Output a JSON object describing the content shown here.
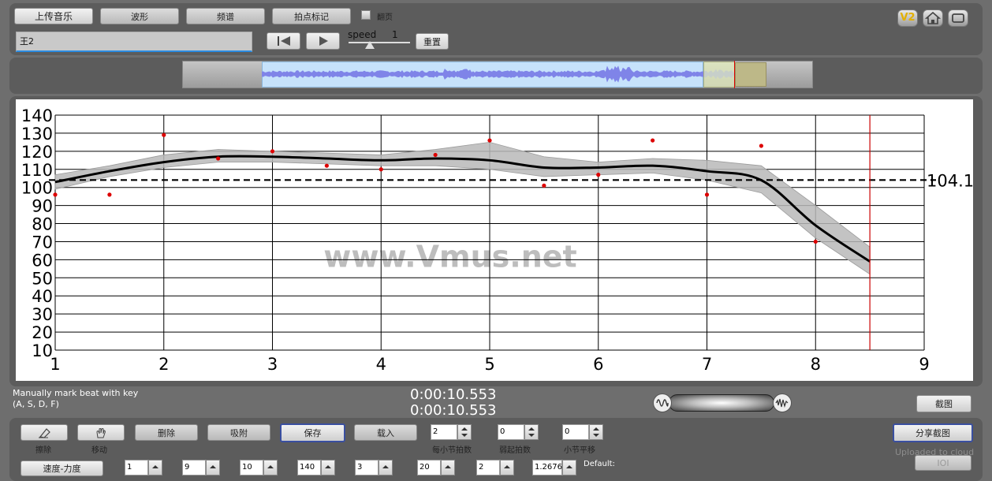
{
  "toolbar": {
    "upload_label": "上传音乐",
    "waveform_label": "波形",
    "spectrum_label": "频谱",
    "beat_mark_label": "拍点标记",
    "page_turn_label": "翻页",
    "track_name": "王2",
    "speed_label": "speed",
    "speed_value": "1",
    "reset_label": "重置",
    "v2_label": "V2"
  },
  "chart_data": {
    "type": "scatter",
    "xlim": [
      1,
      9
    ],
    "ylim": [
      10,
      140
    ],
    "x_ticks": [
      "1",
      "2",
      "3",
      "4",
      "5",
      "6",
      "7",
      "8",
      "9"
    ],
    "y_ticks": [
      "140",
      "130",
      "120",
      "110",
      "100",
      "90",
      "80",
      "70",
      "60",
      "50",
      "40",
      "30",
      "20",
      "10"
    ],
    "points": [
      {
        "x": 1.0,
        "y": 96
      },
      {
        "x": 1.5,
        "y": 96
      },
      {
        "x": 2.0,
        "y": 129
      },
      {
        "x": 2.5,
        "y": 116
      },
      {
        "x": 3.0,
        "y": 120
      },
      {
        "x": 3.5,
        "y": 112
      },
      {
        "x": 4.0,
        "y": 110
      },
      {
        "x": 4.5,
        "y": 118
      },
      {
        "x": 5.0,
        "y": 126
      },
      {
        "x": 5.5,
        "y": 101
      },
      {
        "x": 6.0,
        "y": 107
      },
      {
        "x": 6.5,
        "y": 126
      },
      {
        "x": 7.0,
        "y": 96
      },
      {
        "x": 7.5,
        "y": 123
      },
      {
        "x": 8.0,
        "y": 70
      }
    ],
    "trend": [
      {
        "x": 1.0,
        "y": 103,
        "lo": 99,
        "hi": 107
      },
      {
        "x": 1.5,
        "y": 109,
        "lo": 106,
        "hi": 112
      },
      {
        "x": 2.0,
        "y": 114,
        "lo": 111,
        "hi": 118
      },
      {
        "x": 2.5,
        "y": 117,
        "lo": 114,
        "hi": 121
      },
      {
        "x": 3.0,
        "y": 117,
        "lo": 114,
        "hi": 120
      },
      {
        "x": 3.5,
        "y": 116,
        "lo": 113,
        "hi": 119
      },
      {
        "x": 4.0,
        "y": 115,
        "lo": 112,
        "hi": 118
      },
      {
        "x": 4.5,
        "y": 116,
        "lo": 112,
        "hi": 121
      },
      {
        "x": 5.0,
        "y": 115,
        "lo": 110,
        "hi": 125
      },
      {
        "x": 5.5,
        "y": 111,
        "lo": 106,
        "hi": 117
      },
      {
        "x": 6.0,
        "y": 111,
        "lo": 107,
        "hi": 114
      },
      {
        "x": 6.5,
        "y": 112,
        "lo": 108,
        "hi": 116
      },
      {
        "x": 7.0,
        "y": 109,
        "lo": 104,
        "hi": 115
      },
      {
        "x": 7.5,
        "y": 104,
        "lo": 97,
        "hi": 112
      },
      {
        "x": 8.0,
        "y": 79,
        "lo": 72,
        "hi": 90
      },
      {
        "x": 8.5,
        "y": 59,
        "lo": 52,
        "hi": 67
      }
    ],
    "average": 104.1,
    "average_label": "104.1",
    "cursor_x": 8.5,
    "grid": true,
    "watermark": "www.Vmus.net"
  },
  "status": {
    "hint_line1": "Manually mark beat with key",
    "hint_line2": "(A, S, D, F)",
    "time1": "0:00:10.553",
    "time2": "0:00:10.553",
    "screenshot_label": "截图"
  },
  "tools": {
    "erase_label": "擦除",
    "move_label": "移动",
    "delete_label": "删除",
    "absorb_label": "吸附",
    "save_label": "保存",
    "load_label": "载入",
    "beats_per_bar_label": "每小节拍数",
    "beats_per_bar_value": "2",
    "pickup_label": "弱起拍数",
    "pickup_value": "0",
    "bar_shift_label": "小节平移",
    "bar_shift_value": "0",
    "share_label": "分享截图",
    "uploaded_label": "Uploaded to cloud",
    "ioi_label": "IOI",
    "tempo_dyn_label": "速度-力度",
    "params": [
      "1",
      "9",
      "10",
      "140",
      "3",
      "20",
      "2",
      "1.2676"
    ],
    "default_label": "Default:"
  },
  "colors": {
    "accent": "#3a4fa0",
    "cursor": "#cc0000",
    "point": "#dd0000",
    "band": "#b8b8b8",
    "waveform": "#7f84e8"
  }
}
